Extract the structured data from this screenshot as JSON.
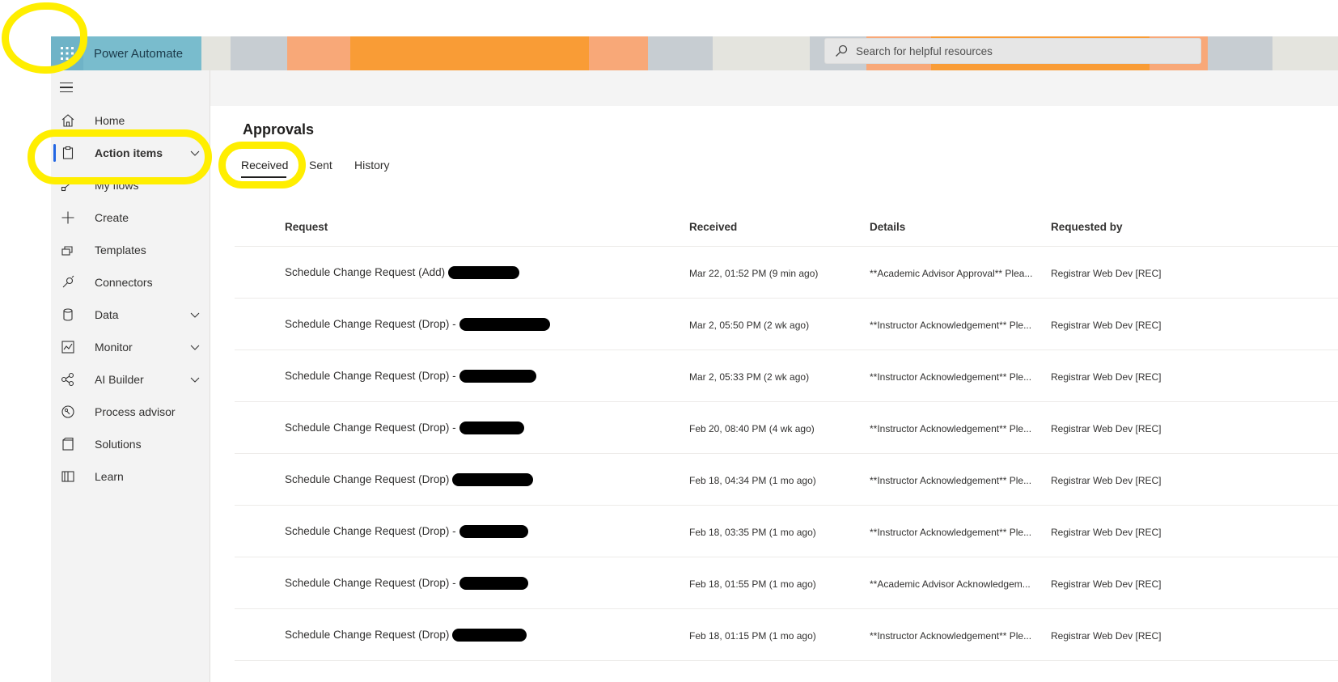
{
  "app": {
    "name": "Power Automate"
  },
  "search": {
    "placeholder": "Search for helpful resources"
  },
  "sidebar": {
    "items": [
      {
        "label": "Home",
        "icon": "home-icon"
      },
      {
        "label": "Action items",
        "icon": "clipboard-icon",
        "active": true,
        "expandable": true
      },
      {
        "label": "My flows",
        "icon": "flow-icon"
      },
      {
        "label": "Create",
        "icon": "plus-icon"
      },
      {
        "label": "Templates",
        "icon": "templates-icon"
      },
      {
        "label": "Connectors",
        "icon": "connector-icon"
      },
      {
        "label": "Data",
        "icon": "database-icon",
        "expandable": true
      },
      {
        "label": "Monitor",
        "icon": "monitor-icon",
        "expandable": true
      },
      {
        "label": "AI Builder",
        "icon": "ai-builder-icon",
        "expandable": true
      },
      {
        "label": "Process advisor",
        "icon": "process-advisor-icon"
      },
      {
        "label": "Solutions",
        "icon": "solutions-icon"
      },
      {
        "label": "Learn",
        "icon": "book-icon"
      }
    ]
  },
  "page": {
    "title": "Approvals",
    "tabs": [
      {
        "label": "Received",
        "active": true
      },
      {
        "label": "Sent"
      },
      {
        "label": "History"
      }
    ]
  },
  "table": {
    "columns": [
      "Request",
      "Received",
      "Details",
      "Requested by"
    ],
    "rows": [
      {
        "request": "Schedule Change Request (Add)",
        "received": "Mar 22, 01:52 PM (9 min ago)",
        "details": "**Academic Advisor Approval** Plea...",
        "requested_by": "Registrar Web Dev [REC]"
      },
      {
        "request": "Schedule Change Request (Drop) -",
        "received": "Mar 2, 05:50 PM (2 wk ago)",
        "details": "**Instructor Acknowledgement** Ple...",
        "requested_by": "Registrar Web Dev [REC]"
      },
      {
        "request": "Schedule Change Request (Drop) -",
        "received": "Mar 2, 05:33 PM (2 wk ago)",
        "details": "**Instructor Acknowledgement** Ple...",
        "requested_by": "Registrar Web Dev [REC]"
      },
      {
        "request": "Schedule Change Request (Drop) -",
        "received": "Feb 20, 08:40 PM (4 wk ago)",
        "details": "**Instructor Acknowledgement** Ple...",
        "requested_by": "Registrar Web Dev [REC]"
      },
      {
        "request": "Schedule Change Request (Drop)",
        "received": "Feb 18, 04:34 PM (1 mo ago)",
        "details": "**Instructor Acknowledgement** Ple...",
        "requested_by": "Registrar Web Dev [REC]"
      },
      {
        "request": "Schedule Change Request (Drop) -",
        "received": "Feb 18, 03:35 PM (1 mo ago)",
        "details": "**Instructor Acknowledgement** Ple...",
        "requested_by": "Registrar Web Dev [REC]"
      },
      {
        "request": "Schedule Change Request (Drop) -",
        "received": "Feb 18, 01:55 PM (1 mo ago)",
        "details": "**Academic Advisor Acknowledgem...",
        "requested_by": "Registrar Web Dev [REC]"
      },
      {
        "request": "Schedule Change Request (Drop)",
        "received": "Feb 18, 01:15 PM (1 mo ago)",
        "details": "**Instructor Acknowledgement** Ple...",
        "requested_by": "Registrar Web Dev [REC]"
      }
    ]
  },
  "colors": {
    "waffle_bg": "#6fb3c7",
    "brand_bg": "#79bccd",
    "banner_orange": "#f99c36",
    "banner_peach": "#f8a878",
    "banner_gray": "#c7cdd2",
    "banner_light": "#e4e4de",
    "active_indicator": "#2266e3",
    "highlight": "#ffee00"
  }
}
